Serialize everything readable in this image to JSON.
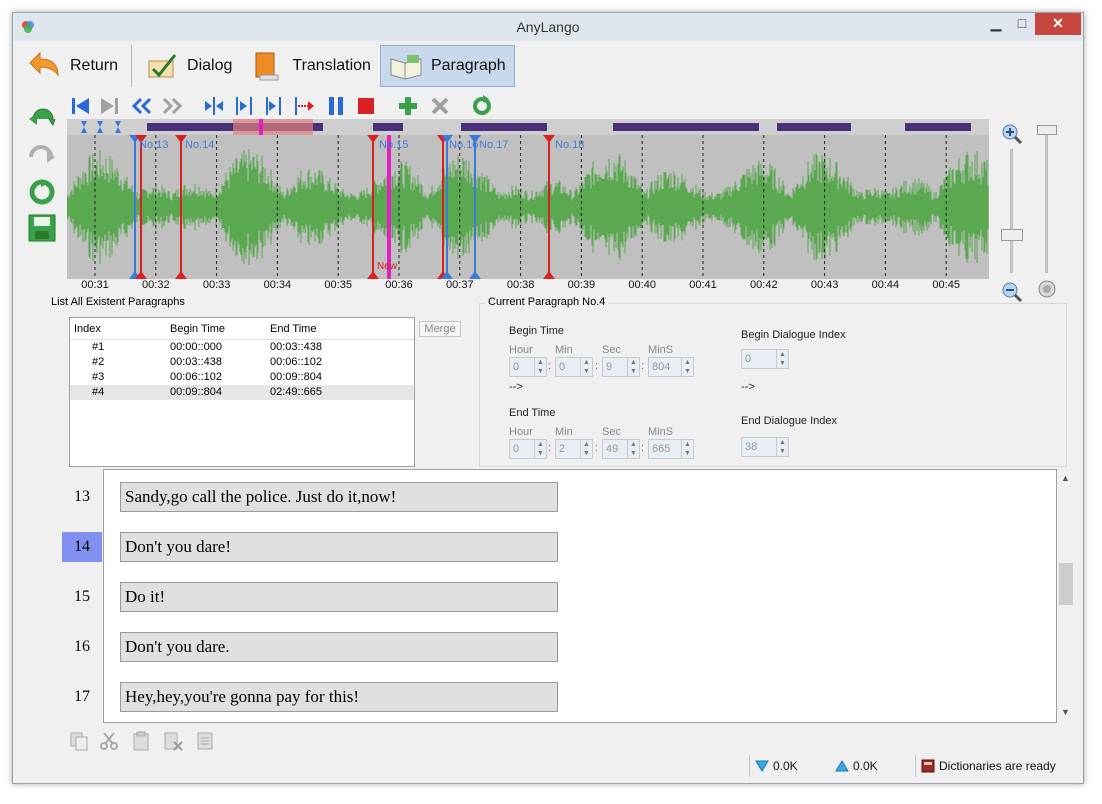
{
  "window": {
    "title": "AnyLango",
    "minimize": "▁",
    "maximize": "□",
    "close": "✕"
  },
  "tabs": [
    {
      "label": "Return",
      "icon": "return-arrow-icon"
    },
    {
      "label": "Dialog",
      "icon": "dialog-icon"
    },
    {
      "label": "Translation",
      "icon": "translation-book-icon"
    },
    {
      "label": "Paragraph",
      "icon": "paragraph-book-icon",
      "active": true
    }
  ],
  "waveform": {
    "markers": [
      "No.13",
      "No.14",
      "No.15",
      "No.16",
      "No.17",
      "No.18"
    ],
    "new_marker": "New",
    "time_ticks": [
      "00:31",
      "00:32",
      "00:33",
      "00:34",
      "00:35",
      "00:36",
      "00:37",
      "00:38",
      "00:39",
      "00:40",
      "00:41",
      "00:42",
      "00:43",
      "00:44",
      "00:45"
    ]
  },
  "paragraph_list": {
    "title": "List All Existent Paragraphs",
    "headers": [
      "Index",
      "Begin Time",
      "End Time"
    ],
    "rows": [
      {
        "index": "#1",
        "begin": "00:00::000",
        "end": "00:03::438"
      },
      {
        "index": "#2",
        "begin": "00:03::438",
        "end": "00:06::102"
      },
      {
        "index": "#3",
        "begin": "00:06::102",
        "end": "00:09::804"
      },
      {
        "index": "#4",
        "begin": "00:09::804",
        "end": "02:49::665"
      }
    ],
    "merge_label": "Merge"
  },
  "current_paragraph": {
    "title": "Current Paragraph No.4",
    "begin_time_label": "Begin Time",
    "end_time_label": "End Time",
    "field_labels": [
      "Hour",
      "Min",
      "Sec",
      "MinS"
    ],
    "begin": {
      "hour": "0",
      "min": "0",
      "sec": "9",
      "mins": "804"
    },
    "end": {
      "hour": "0",
      "min": "2",
      "sec": "49",
      "mins": "665"
    },
    "arrow": "-->",
    "begin_dialogue_label": "Begin Dialogue Index",
    "begin_dialogue_value": "0",
    "end_dialogue_label": "End Dialogue Index",
    "end_dialogue_value": "38"
  },
  "dialogues": [
    {
      "num": "13",
      "text": "Sandy,go call the police. Just do it,now!"
    },
    {
      "num": "14",
      "text": "Don't you dare!",
      "selected": true
    },
    {
      "num": "15",
      "text": "Do it!"
    },
    {
      "num": "16",
      "text": "Don't you dare."
    },
    {
      "num": "17",
      "text": "Hey,hey,you're gonna pay for this!"
    }
  ],
  "status": {
    "down_speed": "0.0K",
    "up_speed": "0.0K",
    "dictionaries": "Dictionaries are ready"
  },
  "colors": {
    "accent": "#c8d9ee",
    "waveform": "#5aa84f",
    "segment": "#4a2f7a",
    "selected_row": "#8090f0"
  }
}
